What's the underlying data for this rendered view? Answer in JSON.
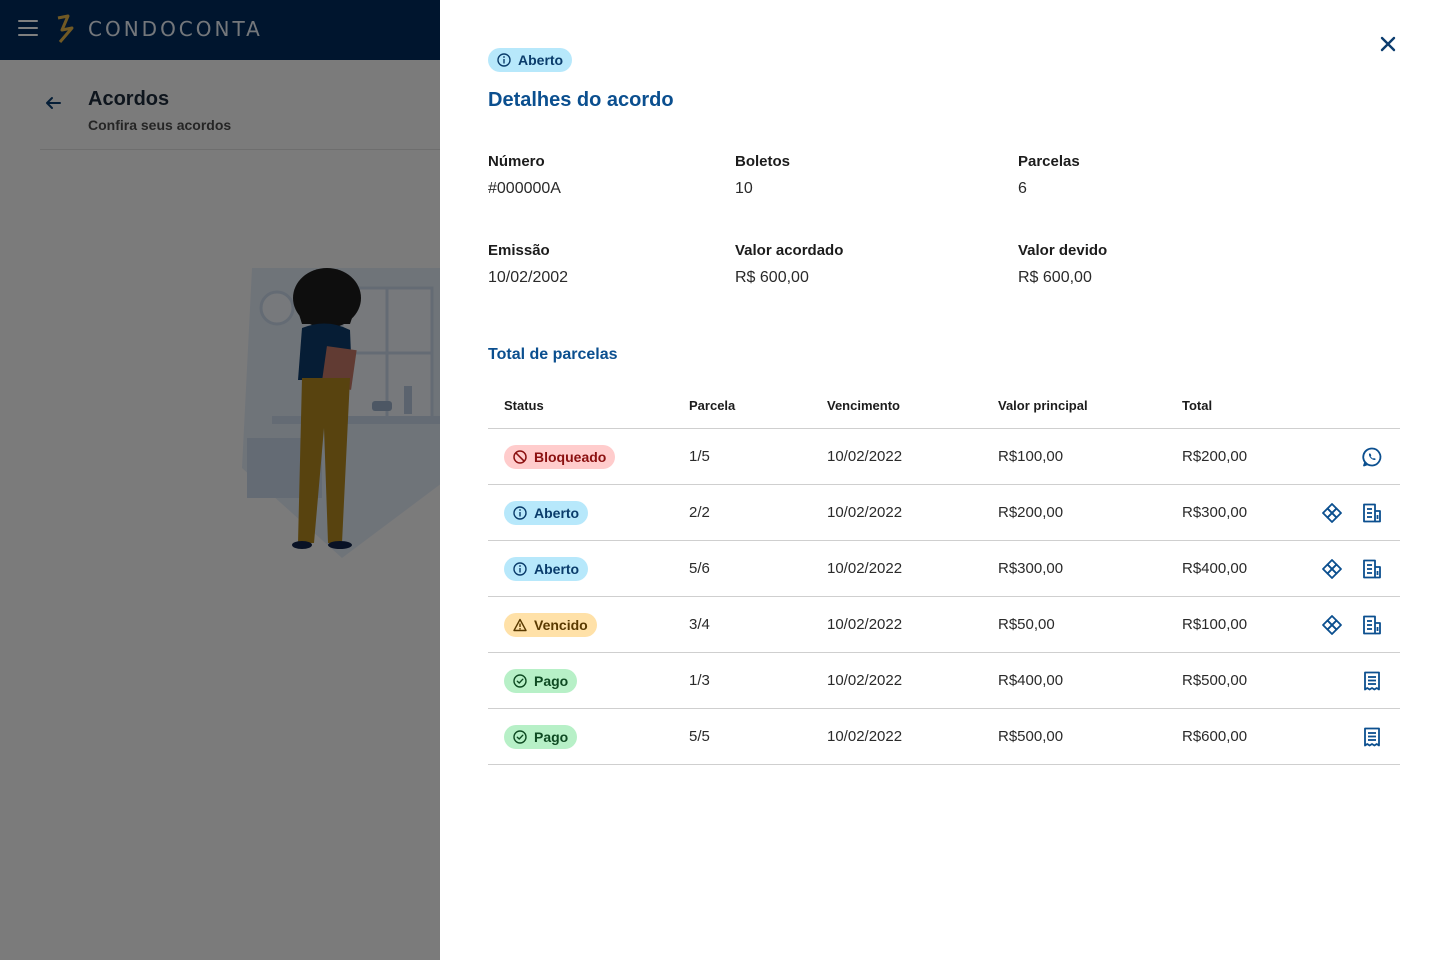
{
  "app": {
    "brand": "CONDOCONTA"
  },
  "page": {
    "title": "Acordos",
    "subtitle": "Confira seus acordos"
  },
  "drawer": {
    "status_badge": "Aberto",
    "title": "Detalhes do acordo",
    "fields": {
      "numero": {
        "label": "Número",
        "value": "#000000A"
      },
      "boletos": {
        "label": "Boletos",
        "value": "10"
      },
      "parcelas": {
        "label": "Parcelas",
        "value": "6"
      },
      "emissao": {
        "label": "Emissão",
        "value": "10/02/2002"
      },
      "valor_acordado": {
        "label": "Valor acordado",
        "value": "R$ 600,00"
      },
      "valor_devido": {
        "label": "Valor devido",
        "value": "R$ 600,00"
      }
    },
    "section_title": "Total de parcelas",
    "table": {
      "headers": {
        "status": "Status",
        "parcela": "Parcela",
        "vencimento": "Vencimento",
        "valor_principal": "Valor principal",
        "total": "Total"
      },
      "rows": [
        {
          "status": "Bloqueado",
          "status_type": "blocked",
          "parcela": "1/5",
          "vencimento": "10/02/2022",
          "valor_principal": "R$100,00",
          "total": "R$200,00",
          "actions": [
            "whatsapp-icon"
          ]
        },
        {
          "status": "Aberto",
          "status_type": "info",
          "parcela": "2/2",
          "vencimento": "10/02/2022",
          "valor_principal": "R$200,00",
          "total": "R$300,00",
          "actions": [
            "pix-icon",
            "boleto-icon"
          ]
        },
        {
          "status": "Aberto",
          "status_type": "info",
          "parcela": "5/6",
          "vencimento": "10/02/2022",
          "valor_principal": "R$300,00",
          "total": "R$400,00",
          "actions": [
            "pix-icon",
            "boleto-icon"
          ]
        },
        {
          "status": "Vencido",
          "status_type": "overdue",
          "parcela": "3/4",
          "vencimento": "10/02/2022",
          "valor_principal": "R$50,00",
          "total": "R$100,00",
          "actions": [
            "pix-icon",
            "boleto-icon"
          ]
        },
        {
          "status": "Pago",
          "status_type": "paid",
          "parcela": "1/3",
          "vencimento": "10/02/2022",
          "valor_principal": "R$400,00",
          "total": "R$500,00",
          "actions": [
            "receipt-icon"
          ]
        },
        {
          "status": "Pago",
          "status_type": "paid",
          "parcela": "5/5",
          "vencimento": "10/02/2022",
          "valor_principal": "R$500,00",
          "total": "R$600,00",
          "actions": [
            "receipt-icon"
          ]
        }
      ]
    }
  },
  "colors": {
    "topbar": "#002b5c",
    "accent": "#0b4f8f",
    "info_badge": "#b7e8fb",
    "blocked_badge": "#ffcccc",
    "overdue_badge": "#ffe1a8",
    "paid_badge": "#b7f0c7"
  }
}
